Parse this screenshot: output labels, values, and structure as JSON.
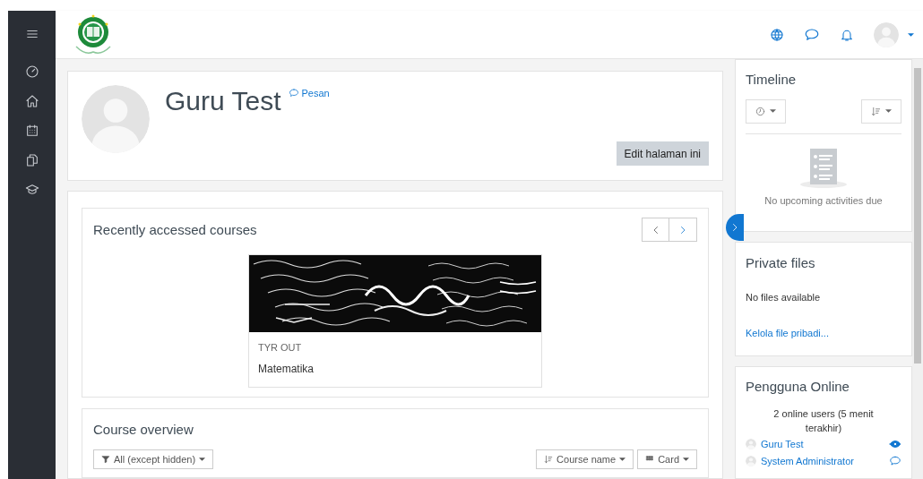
{
  "profile": {
    "name": "Guru Test",
    "message_link": "Pesan",
    "edit_button": "Edit halaman ini"
  },
  "recent_courses": {
    "title": "Recently accessed courses",
    "courses": [
      {
        "category": "TYR OUT",
        "name": "Matematika"
      }
    ]
  },
  "course_overview": {
    "title": "Course overview",
    "filter": "All (except hidden)",
    "sort": "Course name",
    "view": "Card"
  },
  "timeline": {
    "title": "Timeline",
    "empty_message": "No upcoming activities due"
  },
  "private_files": {
    "title": "Private files",
    "message": "No files available",
    "manage_link": "Kelola file pribadi..."
  },
  "online_users": {
    "title": "Pengguna Online",
    "summary": "2 online users (5 menit terakhir)",
    "users": [
      {
        "name": "Guru Test",
        "kind": "self"
      },
      {
        "name": "System Administrator",
        "kind": "other"
      }
    ]
  }
}
